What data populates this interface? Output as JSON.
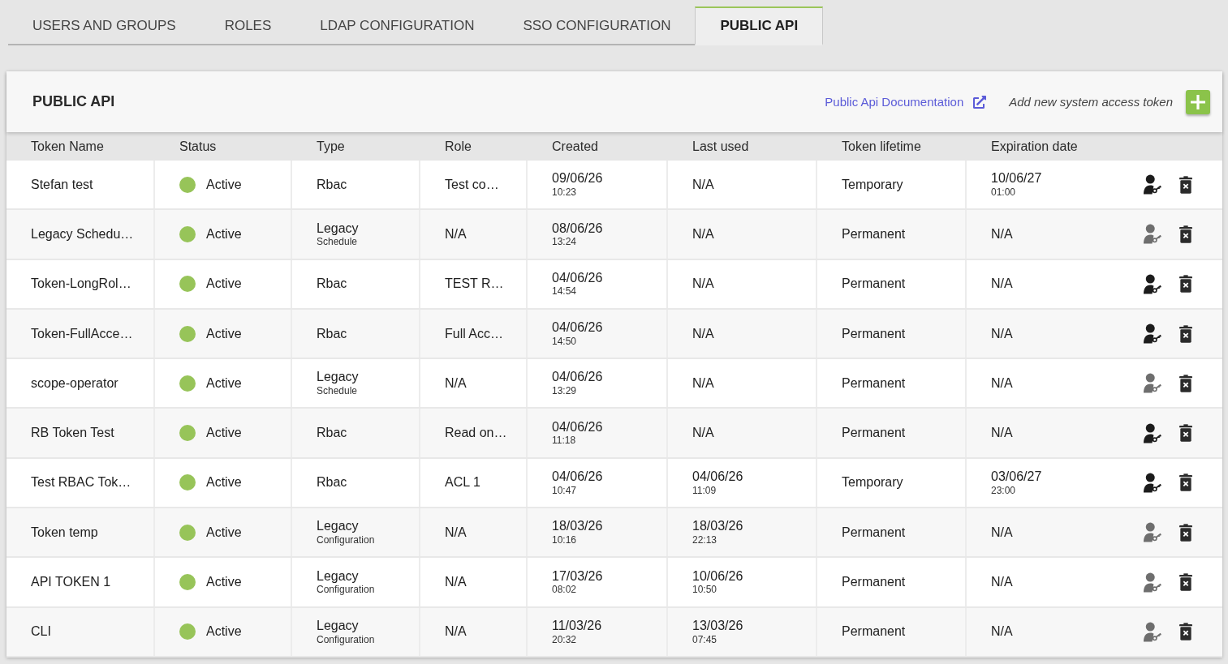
{
  "tabs": [
    {
      "label": "USERS AND GROUPS",
      "selected": false
    },
    {
      "label": "ROLES",
      "selected": false
    },
    {
      "label": "LDAP CONFIGURATION",
      "selected": false
    },
    {
      "label": "SSO CONFIGURATION",
      "selected": false
    },
    {
      "label": "PUBLIC API",
      "selected": true
    }
  ],
  "panel": {
    "title": "PUBLIC API",
    "documentation_link": "Public Api Documentation",
    "add_label": "Add new system access token"
  },
  "table": {
    "columns": [
      "Token Name",
      "Status",
      "Type",
      "Role",
      "Created",
      "Last used",
      "Token lifetime",
      "Expiration date"
    ],
    "rows": [
      {
        "name": "Stefan test",
        "status": {
          "label": "Active",
          "color": "#97c459"
        },
        "type": {
          "text": "Rbac"
        },
        "role": "Test co…",
        "created": {
          "text": "09/06/26",
          "sub": "10:23"
        },
        "last_used": {
          "text": "N/A"
        },
        "lifetime": "Temporary",
        "expiration": {
          "text": "10/06/27",
          "sub": "01:00"
        },
        "role_icon_disabled": false
      },
      {
        "name": "Legacy Schedu…",
        "status": {
          "label": "Active",
          "color": "#97c459"
        },
        "type": {
          "text": "Legacy",
          "sub": "Schedule"
        },
        "role": "N/A",
        "created": {
          "text": "08/06/26",
          "sub": "13:24"
        },
        "last_used": {
          "text": "N/A"
        },
        "lifetime": "Permanent",
        "expiration": {
          "text": "N/A"
        },
        "role_icon_disabled": true
      },
      {
        "name": "Token-LongRol…",
        "status": {
          "label": "Active",
          "color": "#97c459"
        },
        "type": {
          "text": "Rbac"
        },
        "role": "TEST R…",
        "created": {
          "text": "04/06/26",
          "sub": "14:54"
        },
        "last_used": {
          "text": "N/A"
        },
        "lifetime": "Permanent",
        "expiration": {
          "text": "N/A"
        },
        "role_icon_disabled": false
      },
      {
        "name": "Token-FullAcce…",
        "status": {
          "label": "Active",
          "color": "#97c459"
        },
        "type": {
          "text": "Rbac"
        },
        "role": "Full Acc…",
        "created": {
          "text": "04/06/26",
          "sub": "14:50"
        },
        "last_used": {
          "text": "N/A"
        },
        "lifetime": "Permanent",
        "expiration": {
          "text": "N/A"
        },
        "role_icon_disabled": false
      },
      {
        "name": "scope-operator",
        "status": {
          "label": "Active",
          "color": "#97c459"
        },
        "type": {
          "text": "Legacy",
          "sub": "Schedule"
        },
        "role": "N/A",
        "created": {
          "text": "04/06/26",
          "sub": "13:29"
        },
        "last_used": {
          "text": "N/A"
        },
        "lifetime": "Permanent",
        "expiration": {
          "text": "N/A"
        },
        "role_icon_disabled": true
      },
      {
        "name": "RB Token Test",
        "status": {
          "label": "Active",
          "color": "#97c459"
        },
        "type": {
          "text": "Rbac"
        },
        "role": "Read on…",
        "created": {
          "text": "04/06/26",
          "sub": "11:18"
        },
        "last_used": {
          "text": "N/A"
        },
        "lifetime": "Permanent",
        "expiration": {
          "text": "N/A"
        },
        "role_icon_disabled": false
      },
      {
        "name": "Test RBAC Tok…",
        "status": {
          "label": "Active",
          "color": "#97c459"
        },
        "type": {
          "text": "Rbac"
        },
        "role": "ACL 1",
        "created": {
          "text": "04/06/26",
          "sub": "10:47"
        },
        "last_used": {
          "text": "04/06/26",
          "sub": "11:09"
        },
        "lifetime": "Temporary",
        "expiration": {
          "text": "03/06/27",
          "sub": "23:00"
        },
        "role_icon_disabled": false
      },
      {
        "name": "Token temp",
        "status": {
          "label": "Active",
          "color": "#97c459"
        },
        "type": {
          "text": "Legacy",
          "sub": "Configuration"
        },
        "role": "N/A",
        "created": {
          "text": "18/03/26",
          "sub": "10:16"
        },
        "last_used": {
          "text": "18/03/26",
          "sub": "22:13"
        },
        "lifetime": "Permanent",
        "expiration": {
          "text": "N/A"
        },
        "role_icon_disabled": true
      },
      {
        "name": "API TOKEN 1",
        "status": {
          "label": "Active",
          "color": "#97c459"
        },
        "type": {
          "text": "Legacy",
          "sub": "Configuration"
        },
        "role": "N/A",
        "created": {
          "text": "17/03/26",
          "sub": "08:02"
        },
        "last_used": {
          "text": "10/06/26",
          "sub": "10:50"
        },
        "lifetime": "Permanent",
        "expiration": {
          "text": "N/A"
        },
        "role_icon_disabled": true
      },
      {
        "name": "CLI",
        "status": {
          "label": "Active",
          "color": "#97c459"
        },
        "type": {
          "text": "Legacy",
          "sub": "Configuration"
        },
        "role": "N/A",
        "created": {
          "text": "11/03/26",
          "sub": "20:32"
        },
        "last_used": {
          "text": "13/03/26",
          "sub": "07:45"
        },
        "lifetime": "Permanent",
        "expiration": {
          "text": "N/A"
        },
        "role_icon_disabled": true
      }
    ]
  }
}
